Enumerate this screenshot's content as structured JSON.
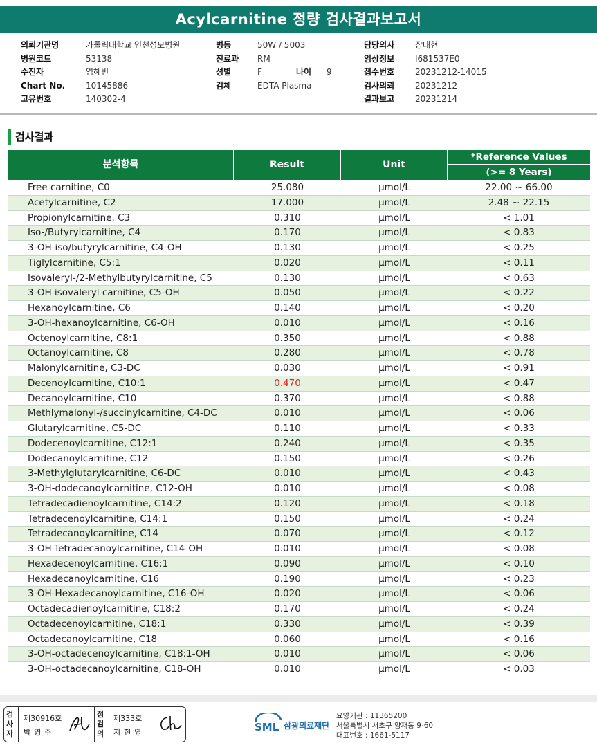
{
  "report": {
    "title": "Acylcarnitine 정량 검사결과보고서",
    "section_title": "검사결과"
  },
  "info": {
    "col1": [
      {
        "label": "의뢰기관명",
        "value": "가톨릭대학교 인천성모병원"
      },
      {
        "label": "병원코드",
        "value": "53138"
      },
      {
        "label": "수진자",
        "value": "염혜빈"
      },
      {
        "label": "Chart No.",
        "value": "10145886"
      },
      {
        "label": "고유번호",
        "value": "140302-4"
      }
    ],
    "col2": [
      {
        "label": "병동",
        "value": "50W / 5003"
      },
      {
        "label": "진료과",
        "value": "RM"
      },
      {
        "label": "성별",
        "value": "F"
      },
      {
        "label": "검체",
        "value": "EDTA Plasma"
      }
    ],
    "age_label": "나이",
    "age_value": "9",
    "col3": [
      {
        "label": "담당의사",
        "value": "장대현"
      },
      {
        "label": "임상정보",
        "value": "I681537E0"
      },
      {
        "label": "접수번호",
        "value": "20231212-14015"
      },
      {
        "label": "검사의뢰",
        "value": "20231212"
      },
      {
        "label": "결과보고",
        "value": "20231214"
      }
    ]
  },
  "table": {
    "headers": {
      "item": "분석항목",
      "result": "Result",
      "unit": "Unit",
      "ref": "*Reference Values",
      "ref_sub": "(>= 8 Years)"
    },
    "abnormal_color": "#e02020",
    "rows": [
      {
        "item": "Free carnitine, C0",
        "result": "25.080",
        "unit": "μmol/L",
        "ref": "22.00 ~ 66.00"
      },
      {
        "item": "Acetylcarnitine, C2",
        "result": "17.000",
        "unit": "μmol/L",
        "ref": "2.48 ~ 22.15"
      },
      {
        "item": "Propionylcarnitine, C3",
        "result": "0.310",
        "unit": "μmol/L",
        "ref": "< 1.01"
      },
      {
        "item": "Iso-/Butyrylcarnitine, C4",
        "result": "0.170",
        "unit": "μmol/L",
        "ref": "< 0.83"
      },
      {
        "item": "3-OH-iso/butyrylcarnitine, C4-OH",
        "result": "0.130",
        "unit": "μmol/L",
        "ref": "< 0.25"
      },
      {
        "item": "Tiglylcarnitine, C5:1",
        "result": "0.020",
        "unit": "μmol/L",
        "ref": "< 0.11"
      },
      {
        "item": "Isovaleryl-/2-Methylbutyrylcarnitine, C5",
        "result": "0.130",
        "unit": "μmol/L",
        "ref": "< 0.63"
      },
      {
        "item": "3-OH isovaleryl carnitine, C5-OH",
        "result": "0.050",
        "unit": "μmol/L",
        "ref": "< 0.22"
      },
      {
        "item": "Hexanoylcarnitine, C6",
        "result": "0.140",
        "unit": "μmol/L",
        "ref": "< 0.20"
      },
      {
        "item": "3-OH-hexanoylcarnitine, C6-OH",
        "result": "0.010",
        "unit": "μmol/L",
        "ref": "< 0.16"
      },
      {
        "item": "Octenoylcarnitine, C8:1",
        "result": "0.350",
        "unit": "μmol/L",
        "ref": "< 0.88"
      },
      {
        "item": "Octanoylcarnitine, C8",
        "result": "0.280",
        "unit": "μmol/L",
        "ref": "< 0.78"
      },
      {
        "item": "Malonylcarnitine, C3-DC",
        "result": "0.030",
        "unit": "μmol/L",
        "ref": "< 0.91"
      },
      {
        "item": "Decenoylcarnitine, C10:1",
        "result": "0.470",
        "unit": "μmol/L",
        "ref": "< 0.47",
        "abnormal": true
      },
      {
        "item": "Decanoylcarnitine, C10",
        "result": "0.370",
        "unit": "μmol/L",
        "ref": "< 0.88"
      },
      {
        "item": "Methlymalonyl-/succinylcarnitine, C4-DC",
        "result": "0.010",
        "unit": "μmol/L",
        "ref": "< 0.06"
      },
      {
        "item": "Glutarylcarnitine, C5-DC",
        "result": "0.110",
        "unit": "μmol/L",
        "ref": "< 0.33"
      },
      {
        "item": "Dodecenoylcarnitine, C12:1",
        "result": "0.240",
        "unit": "μmol/L",
        "ref": "< 0.35"
      },
      {
        "item": "Dodecanoylcarnitine, C12",
        "result": "0.150",
        "unit": "μmol/L",
        "ref": "< 0.26"
      },
      {
        "item": "3-Methylglutarylcarnitine, C6-DC",
        "result": "0.010",
        "unit": "μmol/L",
        "ref": "< 0.43"
      },
      {
        "item": "3-OH-dodecanoylcarnitine, C12-OH",
        "result": "0.010",
        "unit": "μmol/L",
        "ref": "< 0.08"
      },
      {
        "item": "Tetradecadienoylcarnitine, C14:2",
        "result": "0.120",
        "unit": "μmol/L",
        "ref": "< 0.18"
      },
      {
        "item": "Tetradecenoylcarnitine, C14:1",
        "result": "0.150",
        "unit": "μmol/L",
        "ref": "< 0.24"
      },
      {
        "item": "Tetradecanoylcarnitine, C14",
        "result": "0.070",
        "unit": "μmol/L",
        "ref": "< 0.12"
      },
      {
        "item": "3-OH-Tetradecanoylcarnitine, C14-OH",
        "result": "0.010",
        "unit": "μmol/L",
        "ref": "< 0.08"
      },
      {
        "item": "Hexadecenoylcarnitine, C16:1",
        "result": "0.090",
        "unit": "μmol/L",
        "ref": "< 0.10"
      },
      {
        "item": "Hexadecanoylcarnitine, C16",
        "result": "0.190",
        "unit": "μmol/L",
        "ref": "< 0.23"
      },
      {
        "item": "3-OH-Hexadecanoylcarnitine, C16-OH",
        "result": "0.020",
        "unit": "μmol/L",
        "ref": "< 0.06"
      },
      {
        "item": "Octadecadienoylcarnitine, C18:2",
        "result": "0.170",
        "unit": "μmol/L",
        "ref": "< 0.24"
      },
      {
        "item": "Octadecenoylcarnitine, C18:1",
        "result": "0.330",
        "unit": "μmol/L",
        "ref": "< 0.39"
      },
      {
        "item": "Octadecanoylcarnitine, C18",
        "result": "0.060",
        "unit": "μmol/L",
        "ref": "< 0.16"
      },
      {
        "item": "3-OH-octadecenoylcarnitine, C18:1-OH",
        "result": "0.010",
        "unit": "μmol/L",
        "ref": "< 0.06"
      },
      {
        "item": "3-OH-octadecanoylcarnitine, C18-OH",
        "result": "0.010",
        "unit": "μmol/L",
        "ref": "< 0.03"
      }
    ]
  },
  "footer": {
    "sign1_label": "검사자",
    "sign1_no": "제30916호",
    "sign1_name": "박영주",
    "sign2_label": "점검의",
    "sign2_no": "제333호",
    "sign2_name": "지현영",
    "org_logo": "SML",
    "org_name": "삼광의료재단",
    "org_code": "요양기관 : 11365200",
    "org_address": "서울특별시 서초구 양재동 9-60",
    "org_phone": "대표번호 : 1661-5117",
    "brand_color": "#0f7a6e",
    "header_color": "#0e7a3e"
  }
}
